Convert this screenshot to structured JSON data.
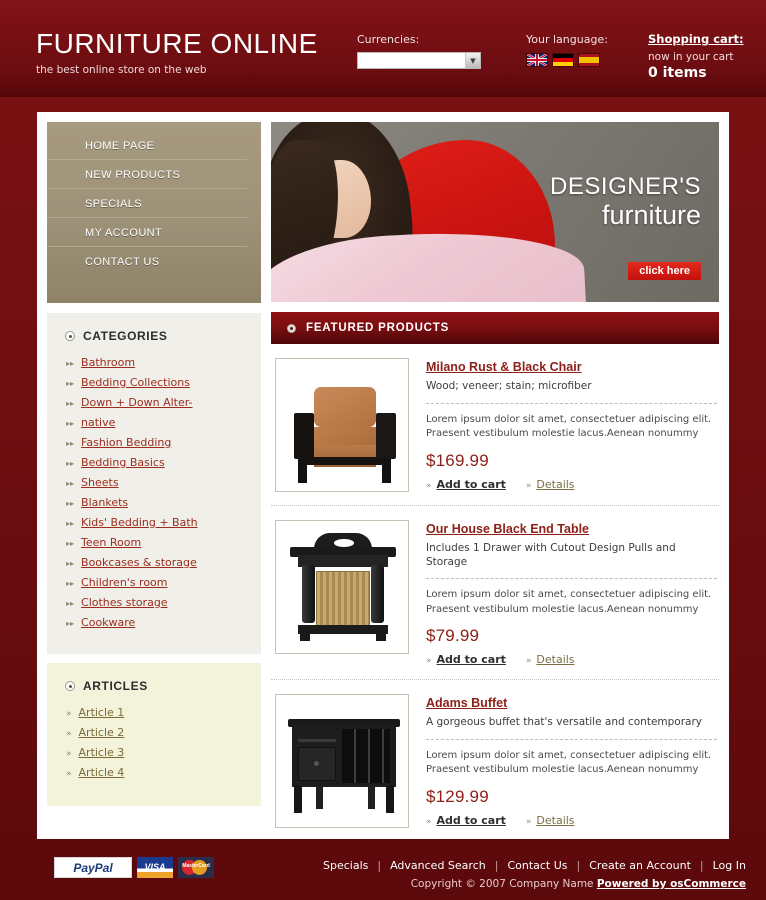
{
  "header": {
    "logo_title": "FURNITURE ONLINE",
    "logo_tagline": "the best online store on the web",
    "currencies_label": "Currencies:",
    "currency_selected": "",
    "language_label": "Your language:",
    "flags": [
      "uk-flag",
      "germany-flag",
      "spain-flag"
    ],
    "cart_title": "Shopping cart:",
    "cart_sub": "now in your cart",
    "cart_count": "0 items"
  },
  "nav": {
    "items": [
      {
        "label": "HOME PAGE"
      },
      {
        "label": "NEW PRODUCTS"
      },
      {
        "label": "SPECIALS"
      },
      {
        "label": "MY ACCOUNT"
      },
      {
        "label": "CONTACT US"
      }
    ]
  },
  "categories": {
    "title": "CATEGORIES",
    "items": [
      {
        "label": "Bathroom"
      },
      {
        "label": "Bedding Collections"
      },
      {
        "label": "Down + Down Alter-"
      },
      {
        "label": "native"
      },
      {
        "label": "Fashion Bedding"
      },
      {
        "label": "Bedding Basics"
      },
      {
        "label": "Sheets"
      },
      {
        "label": "Blankets"
      },
      {
        "label": "Kids' Bedding + Bath"
      },
      {
        "label": "Teen Room "
      },
      {
        "label": "Bookcases & storage"
      },
      {
        "label": "Children's room"
      },
      {
        "label": "Clothes storage"
      },
      {
        "label": "Cookware"
      }
    ]
  },
  "articles": {
    "title": "ARTICLES",
    "items": [
      {
        "label": "Article 1"
      },
      {
        "label": "Article 2"
      },
      {
        "label": "Article 3"
      },
      {
        "label": "Article 4"
      }
    ]
  },
  "banner": {
    "line1": "DESIGNER'S",
    "line2": "furniture",
    "cta": "click here"
  },
  "featured": {
    "title": "FEATURED PRODUCTS",
    "products": [
      {
        "name": "Milano Rust & Black Chair",
        "subtitle": "Wood; veneer; stain; microfiber",
        "description": "Lorem ipsum dolor sit amet, consectetuer adipiscing elit. Praesent vestibulum molestie lacus.Aenean nonummy",
        "price": "$169.99",
        "add_to_cart": "Add to cart",
        "details": "Details"
      },
      {
        "name": "Our House Black End Table ",
        "subtitle": "Includes 1 Drawer with Cutout Design Pulls and Storage",
        "description": "Lorem ipsum dolor sit amet, consectetuer adipiscing elit. Praesent vestibulum molestie lacus.Aenean nonummy",
        "price": "$79.99",
        "add_to_cart": "Add to cart",
        "details": "Details"
      },
      {
        "name": "Adams Buffet ",
        "subtitle": "A gorgeous buffet that's versatile and contemporary",
        "description": "Lorem ipsum dolor sit amet, consectetuer adipiscing elit. Praesent vestibulum molestie lacus.Aenean nonummy",
        "price": "$129.99",
        "add_to_cart": "Add to cart",
        "details": "Details"
      }
    ]
  },
  "footer": {
    "payment_icons": [
      "paypal-logo",
      "visa-logo",
      "mastercard-logo"
    ],
    "paypal_label": "PayPal",
    "visa_label": "VISA",
    "mastercard_label": "MasterCard",
    "links": [
      {
        "label": "Specials"
      },
      {
        "label": "Advanced Search"
      },
      {
        "label": "Contact Us"
      },
      {
        "label": "Create an Account"
      },
      {
        "label": "Log In"
      }
    ],
    "separator": "|",
    "copyright": "Copyright © 2007 Company Name ",
    "powered": "Powered by osCommerce"
  },
  "colors": {
    "brand_red": "#6b0d10",
    "accent_red": "#8e2018",
    "nav_tan": "#9d9178",
    "category_bg": "#f0efe9",
    "articles_bg": "#f3f3dc",
    "link_red": "#9b2d1f"
  }
}
